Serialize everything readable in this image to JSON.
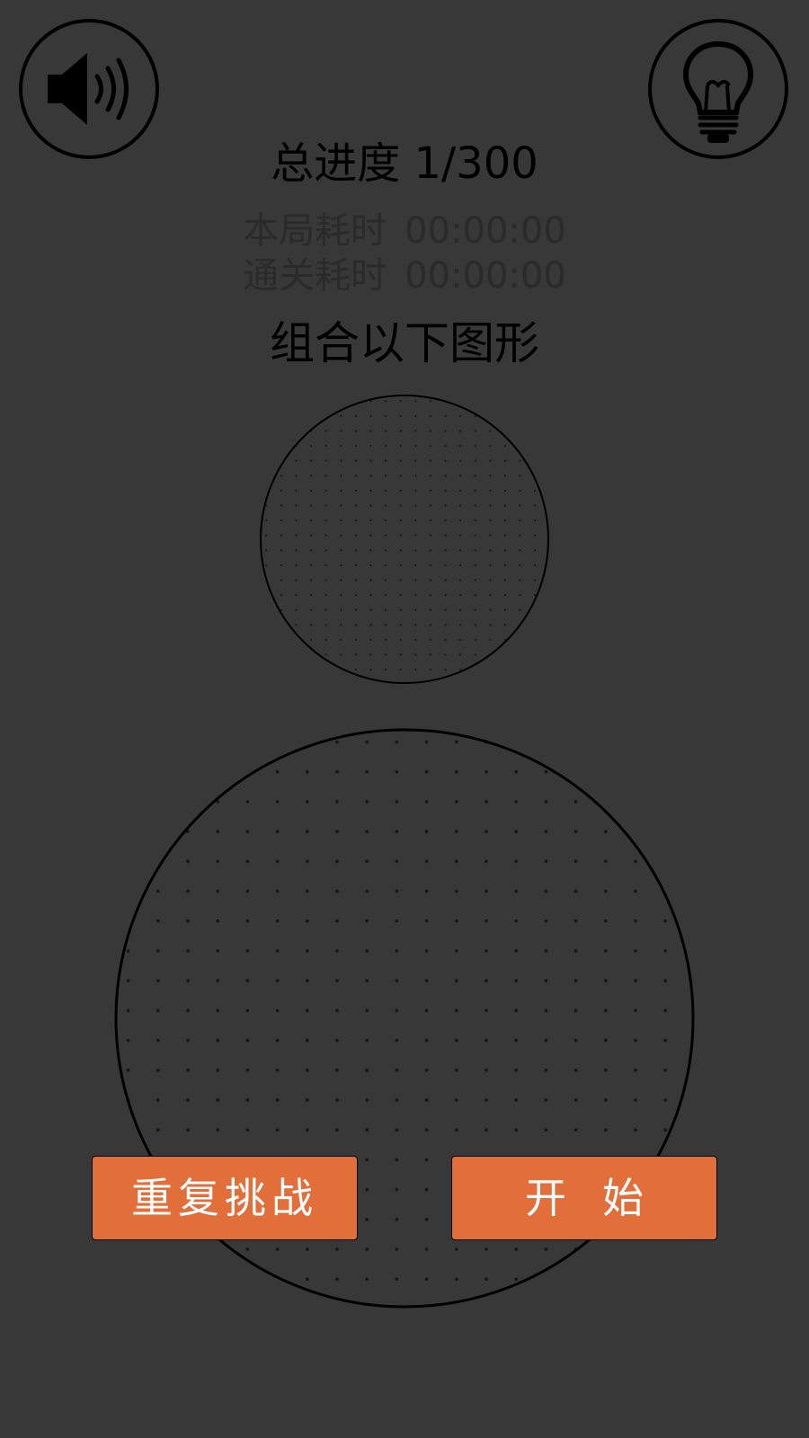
{
  "header": {
    "sound_icon": "speaker-volume-icon",
    "hint_icon": "lightbulb-icon"
  },
  "progress": {
    "label": "总进度",
    "value": "1/300"
  },
  "timers": {
    "round_label": "本局耗时",
    "round_value": "00:00:00",
    "clear_label": "通关耗时",
    "clear_value": "00:00:00"
  },
  "instruction": "组合以下图形",
  "buttons": {
    "retry_label": "重复挑战",
    "start_label": "开始"
  },
  "colors": {
    "background": "#383838",
    "button": "#e26e3a",
    "button_text": "#ffffff"
  }
}
